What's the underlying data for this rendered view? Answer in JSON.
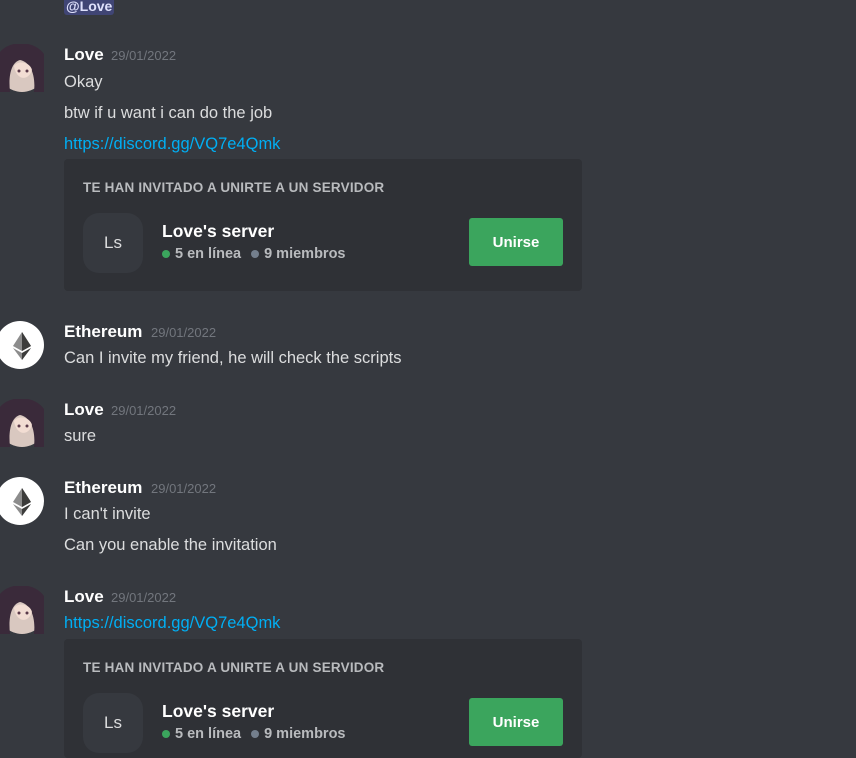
{
  "top_mention": "@Love",
  "messages": [
    {
      "author": "Love",
      "timestamp": "29/01/2022",
      "lines": [
        "Okay",
        "btw if u want i can do the job"
      ],
      "link": "https://discord.gg/VQ7e4Qmk",
      "invite": {
        "header": "TE HAN INVITADO A UNIRTE A UN SERVIDOR",
        "icon_text": "Ls",
        "server_name": "Love's server",
        "online": "5 en línea",
        "members": "9 miembros",
        "button": "Unirse"
      }
    },
    {
      "author": "Ethereum",
      "timestamp": "29/01/2022",
      "lines": [
        "Can I invite my friend, he will check the scripts"
      ]
    },
    {
      "author": "Love",
      "timestamp": "29/01/2022",
      "lines": [
        "sure"
      ]
    },
    {
      "author": "Ethereum",
      "timestamp": "29/01/2022",
      "lines": [
        "I can't invite",
        "Can you enable the invitation"
      ]
    },
    {
      "author": "Love",
      "timestamp": "29/01/2022",
      "link": "https://discord.gg/VQ7e4Qmk",
      "invite": {
        "header": "TE HAN INVITADO A UNIRTE A UN SERVIDOR",
        "icon_text": "Ls",
        "server_name": "Love's server",
        "online": "5 en línea",
        "members": "9 miembros",
        "button": "Unirse"
      }
    }
  ],
  "colors": {
    "background": "#36393f",
    "embed": "#2f3136",
    "link": "#00aff4",
    "join": "#3ba55d"
  }
}
